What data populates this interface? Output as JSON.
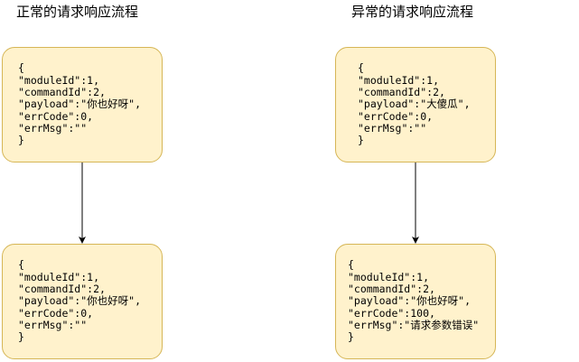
{
  "titles": {
    "left": "正常的请求响应流程",
    "right": "异常的请求响应流程"
  },
  "boxes": {
    "left_top": [
      "{",
      "\"moduleId\":1,",
      "\"commandId\":2,",
      "\"payload\":\"你也好呀\",",
      "\"errCode\":0,",
      "\"errMsg\":\"\"",
      "}"
    ],
    "left_bottom": [
      "{",
      "\"moduleId\":1,",
      "\"commandId\":2,",
      "\"payload\":\"你也好呀\",",
      "\"errCode\":0,",
      "\"errMsg\":\"\"",
      "}"
    ],
    "right_top": [
      "{",
      "\"moduleId\":1,",
      "\"commandId\":2,",
      "\"payload\":\"大傻瓜\",",
      "\"errCode\":0,",
      "\"errMsg\":\"\"",
      "}"
    ],
    "right_bottom": [
      "{",
      "\"moduleId\":1,",
      "\"commandId\":2,",
      "\"payload\":\"你也好呀\",",
      "\"errCode\":100,",
      "\"errMsg\":\"请求参数错误\"",
      "}"
    ]
  },
  "colors": {
    "box_fill": "#fff2cc",
    "box_stroke": "#d6b656",
    "arrow": "#000000"
  }
}
